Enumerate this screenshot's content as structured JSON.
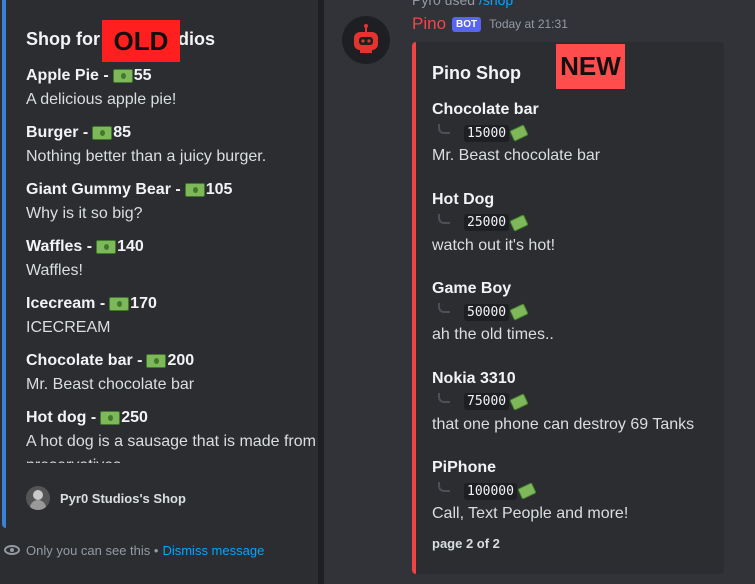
{
  "old": {
    "overlay_label": "OLD",
    "title": "Shop for Pyr0 Studios",
    "items": [
      {
        "name": "Apple Pie -",
        "price": "55",
        "desc": "A delicious apple pie!"
      },
      {
        "name": "Burger -",
        "price": "85",
        "desc": "Nothing better than a juicy burger."
      },
      {
        "name": "Giant Gummy Bear -",
        "price": "105",
        "desc": "Why is it so big?"
      },
      {
        "name": "Waffles -",
        "price": "140",
        "desc": "Waffles!"
      },
      {
        "name": "Icecream -",
        "price": "170",
        "desc": "ICECREAM"
      },
      {
        "name": "Chocolate bar -",
        "price": "200",
        "desc": "Mr. Beast chocolate bar"
      },
      {
        "name": "Hot dog -",
        "price": "250",
        "desc": "A hot dog is a sausage that is made from preservatives"
      }
    ],
    "footer": "Pyr0 Studios's Shop",
    "ephemeral_text": "Only you can see this •",
    "dismiss_label": "Dismiss message"
  },
  "new": {
    "overlay_label": "NEW",
    "used_line_user": "Pyr0 used",
    "used_line_cmd": "/shop",
    "bot_name": "Pino",
    "bot_badge": "BOT",
    "timestamp": "Today at 21:31",
    "title": "Pino Shop",
    "items": [
      {
        "name": "Chocolate bar",
        "price": "15000",
        "desc": "Mr. Beast chocolate bar"
      },
      {
        "name": "Hot Dog",
        "price": "25000",
        "desc": "watch out it's hot!"
      },
      {
        "name": "Game Boy",
        "price": "50000",
        "desc": "ah the old times.."
      },
      {
        "name": "Nokia 3310",
        "price": "75000",
        "desc": "that one phone can destroy 69 Tanks"
      },
      {
        "name": "PiPhone",
        "price": "100000",
        "desc": "Call, Text People and more!"
      }
    ],
    "page_indicator": "page 2 of 2"
  },
  "colors": {
    "old_accent": "#3b82d6",
    "new_accent": "#ef4444",
    "bot_badge": "#5865f2",
    "link": "#00a8fc"
  },
  "icons": {
    "price": "dollar-banknote-icon",
    "new_price": "money-with-wings-icon",
    "ephemeral": "eye-icon",
    "bot_avatar": "robot-icon"
  }
}
